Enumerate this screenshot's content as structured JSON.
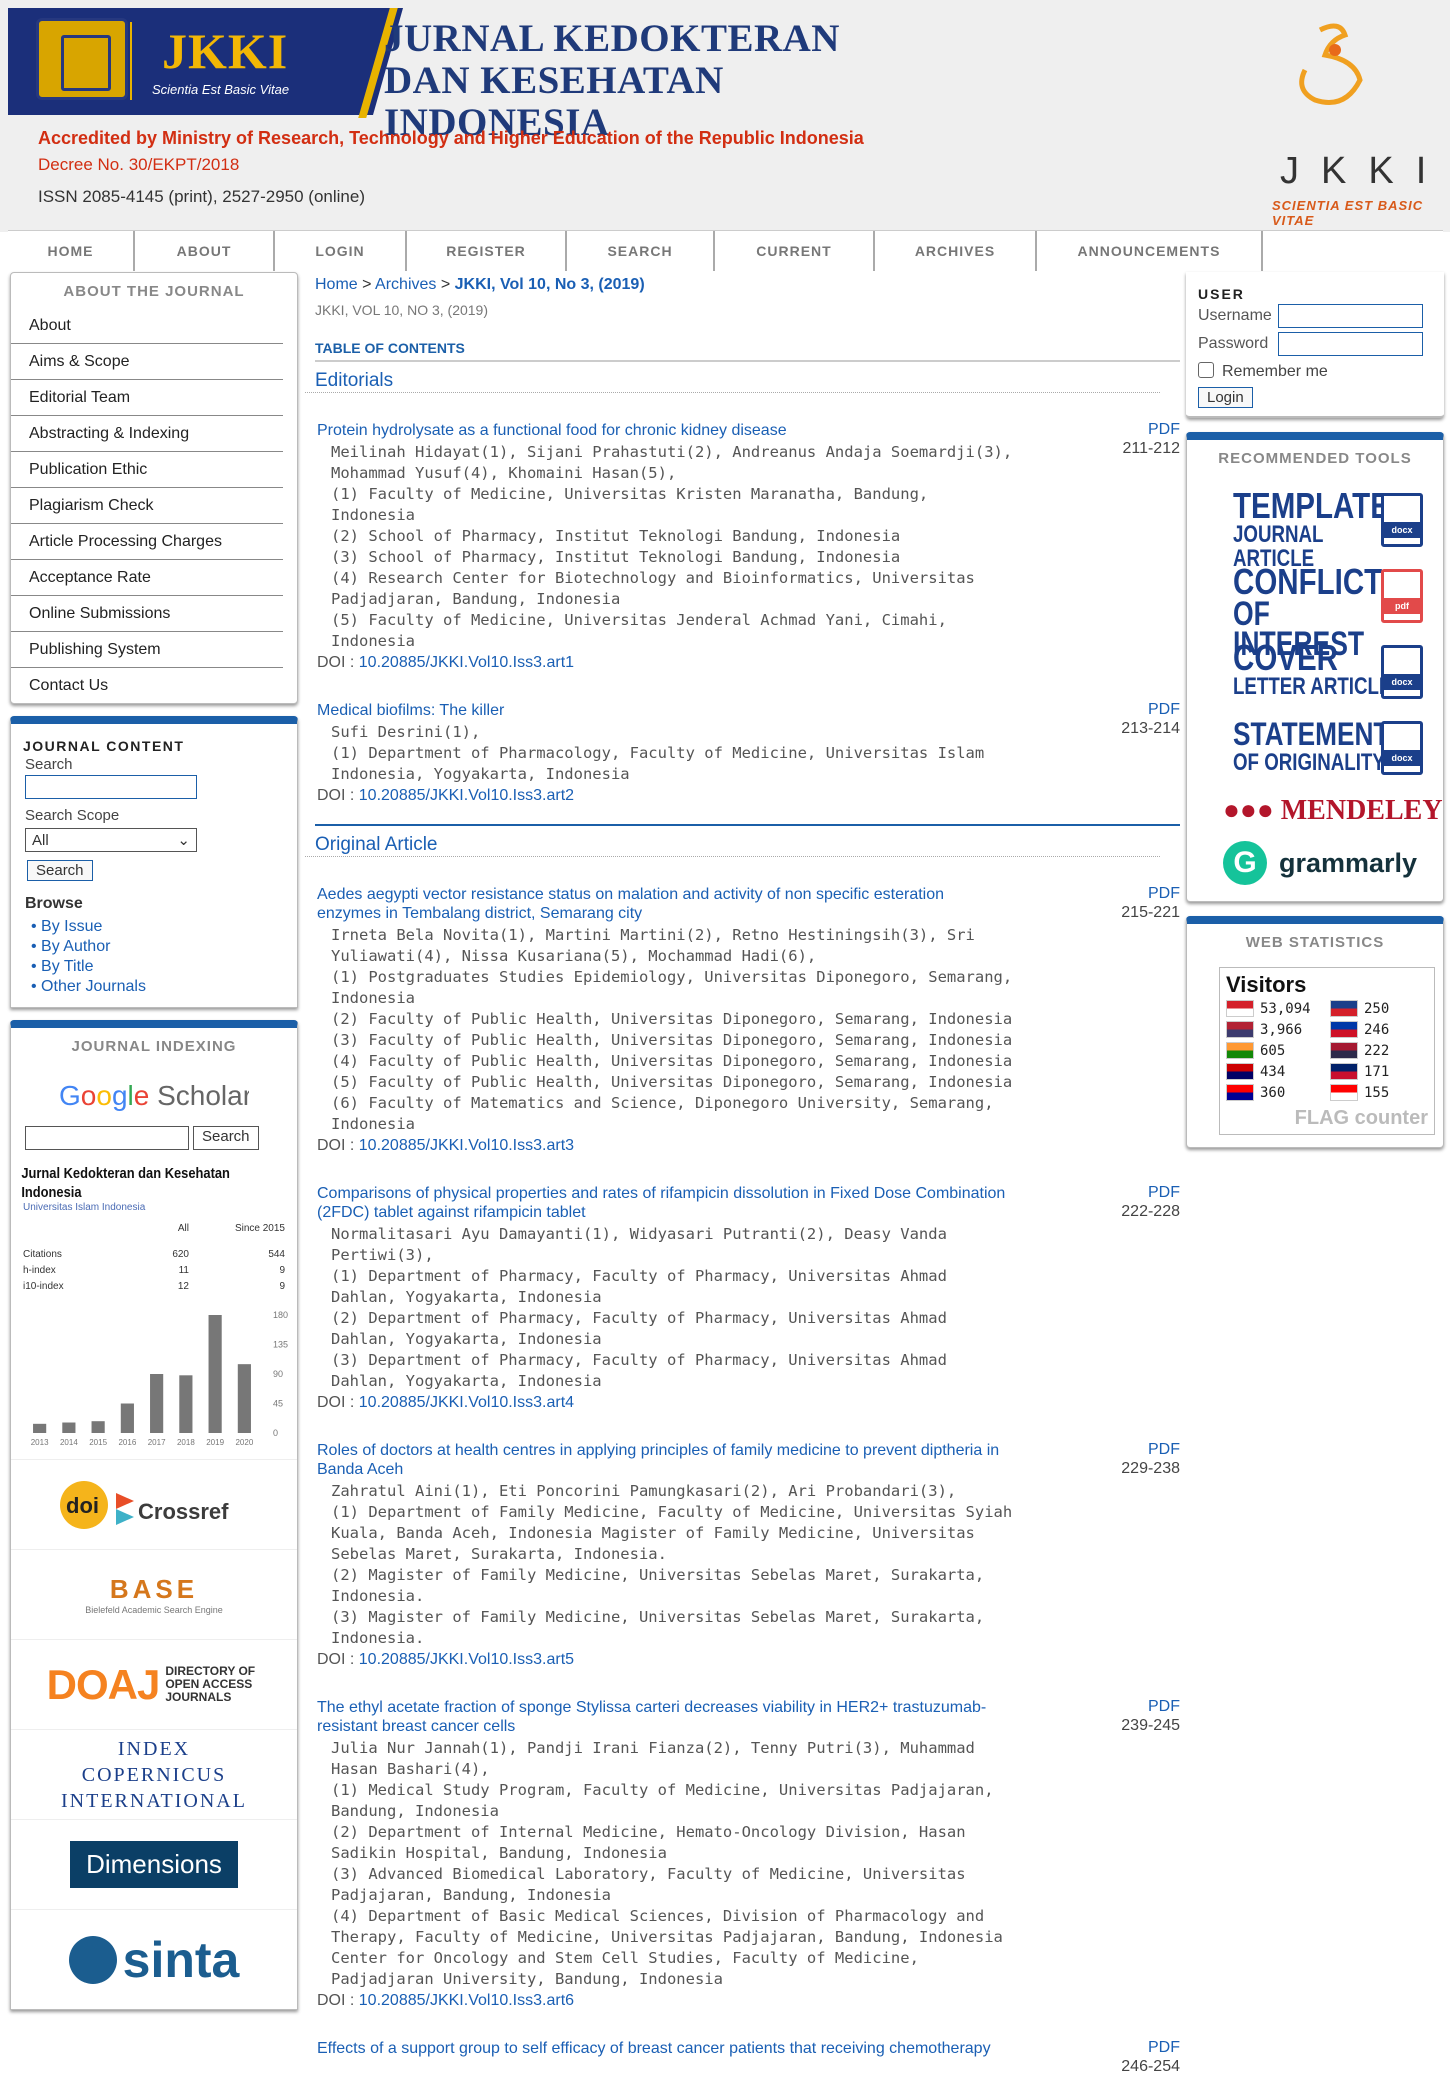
{
  "header": {
    "short_name": "JKKI",
    "motto": "Scientia Est Basic Vitae",
    "journal_name": "JURNAL KEDOKTERAN DAN KESEHATAN INDONESIA",
    "accreditation": "Accredited by Ministry of Research, Technology and Higher Education of the Republic Indonesia",
    "decree": "Decree No. 30/EKPT/2018",
    "issn": "ISSN 2085-4145 (print), 2527-2950 (online)",
    "logo_right_text": "JKKI",
    "logo_right_motto": "SCIENTIA EST BASIC VITAE"
  },
  "nav": [
    "HOME",
    "ABOUT",
    "LOGIN",
    "REGISTER",
    "SEARCH",
    "CURRENT",
    "ARCHIVES",
    "ANNOUNCEMENTS"
  ],
  "about_box": {
    "title": "ABOUT THE JOURNAL",
    "links": [
      "About",
      "Aims & Scope",
      "Editorial Team",
      "Abstracting & Indexing",
      "Publication Ethic",
      "Plagiarism Check",
      "Article Processing Charges",
      "Acceptance Rate",
      "Online Submissions",
      "Publishing System",
      "Contact Us"
    ]
  },
  "journal_content": {
    "title": "JOURNAL CONTENT",
    "search_label": "Search",
    "scope_label": "Search Scope",
    "scope_value": "All",
    "search_button": "Search",
    "browse_title": "Browse",
    "browse_items": [
      "By Issue",
      "By Author",
      "By Title",
      "Other Journals"
    ]
  },
  "indexing": {
    "title": "JOURNAL INDEXING",
    "gs_search_button": "Search",
    "gs_journal": "Jurnal Kedokteran dan Kesehatan Indonesia",
    "gs_univ": "Universitas Islam Indonesia",
    "gs_headers": [
      "",
      "All",
      "Since 2015"
    ],
    "gs_rows": [
      [
        "Citations",
        "620",
        "544"
      ],
      [
        "h-index",
        "11",
        "9"
      ],
      [
        "i10-index",
        "12",
        "9"
      ]
    ],
    "copernicus": "INDEX COPERNICUS INTERNATIONAL",
    "dimensions": "Dimensions",
    "sinta": "sinta",
    "doaj": "DOAJ",
    "doaj_sub": "DIRECTORY OF OPEN ACCESS JOURNALS",
    "base": "BASE",
    "base_sub": "Bielefeld Academic Search Engine",
    "crossref": "Crossref"
  },
  "chart_data": {
    "type": "bar",
    "categories": [
      "2013",
      "2014",
      "2015",
      "2016",
      "2017",
      "2018",
      "2019",
      "2020"
    ],
    "values": [
      14,
      16,
      18,
      45,
      90,
      88,
      180,
      105
    ],
    "ylim": [
      0,
      180
    ],
    "yticks": [
      "180",
      "135",
      "90",
      "45",
      "0"
    ]
  },
  "main": {
    "breadcrumb_home": "Home",
    "breadcrumb_archives": "Archives",
    "breadcrumb_current": "JKKI, Vol 10, No 3, (2019)",
    "issue_sub": "JKKI, VOL 10, NO 3, (2019)",
    "toc": "TABLE OF CONTENTS",
    "sections": [
      "Editorials",
      "Original Article"
    ],
    "articles": [
      {
        "title": "Protein hydrolysate as a functional food for chronic kidney disease",
        "pdf": "PDF",
        "pages": "211-212",
        "body": "Meilinah Hidayat(1), Sijani Prahastuti(2), Andreanus Andaja Soemardji(3), Mohammad Yusuf(4), Khomaini Hasan(5),\n(1) Faculty of Medicine, Universitas Kristen Maranatha, Bandung, Indonesia\n(2) School of Pharmacy, Institut Teknologi Bandung, Indonesia\n(3) School of Pharmacy, Institut Teknologi Bandung, Indonesia\n(4) Research Center for Biotechnology and Bioinformatics, Universitas Padjadjaran, Bandung, Indonesia\n(5) Faculty of Medicine, Universitas Jenderal Achmad Yani, Cimahi, Indonesia",
        "doi": "10.20885/JKKI.Vol10.Iss3.art1"
      },
      {
        "title": "Medical biofilms: The killer",
        "pdf": "PDF",
        "pages": "213-214",
        "body": "Sufi Desrini(1),\n(1) Department of Pharmacology, Faculty of Medicine, Universitas Islam Indonesia, Yogyakarta, Indonesia",
        "doi": "10.20885/JKKI.Vol10.Iss3.art2"
      },
      {
        "title": "Aedes aegypti vector resistance status on malation and activity of non specific esteration enzymes in Tembalang district, Semarang city",
        "pdf": "PDF",
        "pages": "215-221",
        "body": "Irneta Bela Novita(1), Martini Martini(2), Retno Hestiningsih(3), Sri Yuliawati(4), Nissa Kusariana(5), Mochammad Hadi(6),\n(1) Postgraduates Studies Epidemiology, Universitas Diponegoro, Semarang, Indonesia\n(2) Faculty of Public Health, Universitas Diponegoro, Semarang, Indonesia\n(3) Faculty of Public Health, Universitas Diponegoro, Semarang, Indonesia\n(4) Faculty of Public Health, Universitas Diponegoro, Semarang, Indonesia\n(5) Faculty of Public Health, Universitas Diponegoro, Semarang, Indonesia\n(6) Faculty of Matematics and Science, Diponegoro University, Semarang, Indonesia",
        "doi": "10.20885/JKKI.Vol10.Iss3.art3"
      },
      {
        "title": "Comparisons of physical properties and rates of rifampicin dissolution in Fixed Dose Combination (2FDC) tablet against rifampicin tablet",
        "pdf": "PDF",
        "pages": "222-228",
        "body": "Normalitasari Ayu Damayanti(1), Widyasari Putranti(2), Deasy Vanda Pertiwi(3),\n(1) Department of Pharmacy, Faculty of Pharmacy, Universitas Ahmad Dahlan, Yogyakarta, Indonesia\n(2) Department of Pharmacy, Faculty of Pharmacy, Universitas Ahmad Dahlan, Yogyakarta, Indonesia\n(3) Department of Pharmacy, Faculty of Pharmacy, Universitas Ahmad Dahlan, Yogyakarta, Indonesia",
        "doi": "10.20885/JKKI.Vol10.Iss3.art4"
      },
      {
        "title": "Roles of doctors at health centres in applying principles of family medicine to prevent diptheria in Banda Aceh",
        "pdf": "PDF",
        "pages": "229-238",
        "body": "Zahratul Aini(1), Eti Poncorini Pamungkasari(2), Ari Probandari(3),\n(1) Department of Family Medicine, Faculty of Medicine, Universitas Syiah Kuala, Banda Aceh, Indonesia Magister of Family Medicine, Universitas Sebelas Maret, Surakarta, Indonesia.\n(2) Magister of Family Medicine, Universitas Sebelas Maret, Surakarta, Indonesia.\n(3) Magister of Family Medicine, Universitas Sebelas Maret, Surakarta, Indonesia.",
        "doi": "10.20885/JKKI.Vol10.Iss3.art5"
      },
      {
        "title": "The ethyl acetate fraction of sponge Stylissa carteri decreases viability in HER2+ trastuzumab-resistant breast cancer cells",
        "pdf": "PDF",
        "pages": "239-245",
        "body": "Julia Nur Jannah(1), Pandji Irani Fianza(2), Tenny Putri(3), Muhammad Hasan Bashari(4),\n(1) Medical Study Program, Faculty of Medicine, Universitas Padjajaran, Bandung, Indonesia\n(2) Department of Internal Medicine, Hemato-Oncology Division, Hasan Sadikin Hospital, Bandung, Indonesia\n(3) Advanced Biomedical Laboratory, Faculty of Medicine, Universitas Padjajaran, Bandung, Indonesia\n(4) Department of Basic Medical Sciences, Division of Pharmacology and Therapy, Faculty of Medicine, Universitas Padjajaran, Bandung, Indonesia Center for Oncology and Stem Cell Studies, Faculty of Medicine, Padjadjaran University, Bandung, Indonesia",
        "doi": "10.20885/JKKI.Vol10.Iss3.art6"
      },
      {
        "title": "Effects of a support group to self efficacy of breast cancer patients that receiving chemotherapy",
        "pdf": "PDF",
        "pages": "246-254",
        "body": "",
        "doi": ""
      }
    ],
    "doi_label": "DOI : "
  },
  "user_box": {
    "title": "USER",
    "username_label": "Username",
    "password_label": "Password",
    "remember_label": "Remember me",
    "login_button": "Login"
  },
  "tools": {
    "title": "RECOMMENDED TOOLS",
    "items": [
      {
        "big": "TEMPLATE",
        "small": "JOURNAL ARTICLE",
        "ext": "docx"
      },
      {
        "big": "CONFLICT",
        "small": "OF INTEREST",
        "ext": "pdf"
      },
      {
        "big": "COVER",
        "small": "LETTER ARTICLE",
        "ext": "docx"
      },
      {
        "big": "STATEMENT",
        "small": "OF ORIGINALITY",
        "ext": "docx"
      }
    ],
    "mendeley": "MENDELEY",
    "grammarly": "grammarly"
  },
  "web_stats": {
    "title": "WEB STATISTICS",
    "visitors": "Visitors",
    "flags": [
      {
        "count": "53,094",
        "colors": [
          "#d4202a",
          "#ffffff"
        ]
      },
      {
        "count": "250",
        "colors": [
          "#1b3f8a",
          "#d4202a"
        ]
      },
      {
        "count": "3,966",
        "colors": [
          "#b22234",
          "#3c3b6e"
        ]
      },
      {
        "count": "246",
        "colors": [
          "#0038a8",
          "#ce1126"
        ]
      },
      {
        "count": "605",
        "colors": [
          "#ff9933",
          "#138808"
        ]
      },
      {
        "count": "222",
        "colors": [
          "#a51931",
          "#2d2a4a"
        ]
      },
      {
        "count": "434",
        "colors": [
          "#cc0001",
          "#010066"
        ]
      },
      {
        "count": "171",
        "colors": [
          "#012169",
          "#c8102e"
        ]
      },
      {
        "count": "360",
        "colors": [
          "#fe0000",
          "#000095"
        ]
      },
      {
        "count": "155",
        "colors": [
          "#ff0000",
          "#ffffff"
        ]
      }
    ],
    "flagcounter": "FLAG counter"
  }
}
